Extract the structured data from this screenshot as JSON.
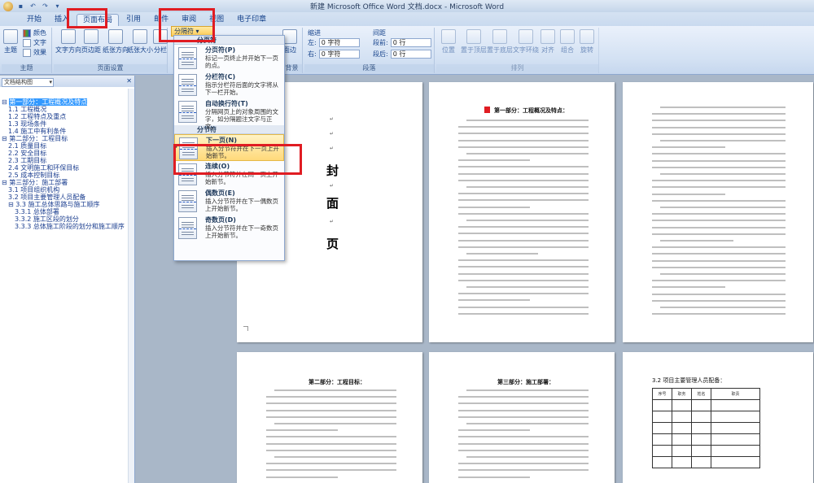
{
  "window": {
    "title": "新建 Microsoft Office Word 文档.docx - Microsoft Word"
  },
  "tabs": [
    "开始",
    "插入",
    "页面布局",
    "引用",
    "邮件",
    "审阅",
    "视图",
    "电子印章"
  ],
  "active_tab": "页面布局",
  "ribbon": {
    "themes": {
      "label": "主题",
      "big": "主题",
      "items": [
        "颜色",
        "文字",
        "效果"
      ]
    },
    "page_setup": {
      "label": "页面设置",
      "buttons": [
        "文字方向",
        "页边距",
        "纸张方向",
        "纸张大小",
        "分栏"
      ]
    },
    "breaks_button": "分隔符",
    "page_background": {
      "label": "页面背景",
      "buttons": [
        "页面边框"
      ]
    },
    "paragraph": {
      "label": "段落",
      "indent_label": "缩进",
      "spacing_label": "间距",
      "left": "左:",
      "right": "右:",
      "left_value": "0 字符",
      "right_value": "0 字符",
      "before": "段前:",
      "after": "段后:",
      "before_value": "0 行",
      "after_value": "0 行"
    },
    "arrange": {
      "label": "排列",
      "buttons": [
        "位置",
        "置于顶层",
        "置于底层",
        "文字环绕",
        "对齐",
        "组合",
        "旋转"
      ]
    }
  },
  "nav_pane": {
    "view_select": "文档结构图",
    "items": [
      {
        "text": "第一部分：工程概况及特点",
        "level": 0,
        "selected": true
      },
      {
        "text": "1.1 工程概况",
        "level": 1
      },
      {
        "text": "1.2 工程特点及重点",
        "level": 1
      },
      {
        "text": "1.3 现场条件",
        "level": 1
      },
      {
        "text": "1.4 施工中有利条件",
        "level": 1
      },
      {
        "text": "第二部分：工程目标",
        "level": 0
      },
      {
        "text": "2.1 质量目标",
        "level": 1
      },
      {
        "text": "2.2 安全目标",
        "level": 1
      },
      {
        "text": "2.3 工期目标",
        "level": 1
      },
      {
        "text": "2.4 文明施工和环保目标",
        "level": 1
      },
      {
        "text": "2.5 成本控制目标",
        "level": 1
      },
      {
        "text": "第三部分：施工部署",
        "level": 0
      },
      {
        "text": "3.1 项目组织机构",
        "level": 1
      },
      {
        "text": "3.2 项目主要管理人员配备",
        "level": 1
      },
      {
        "text": "3.3 施工总体思路与施工顺序",
        "level": 1
      },
      {
        "text": "3.3.1 总体部署",
        "level": 2
      },
      {
        "text": "3.3.2 施工区段的划分",
        "level": 2
      },
      {
        "text": "3.3.3 总体施工阶段的划分和施工顺序",
        "level": 2
      }
    ]
  },
  "breaks_menu": {
    "sections": [
      {
        "header": "分页符",
        "items": [
          {
            "title": "分页符(P)",
            "desc": "标记一页终止并开始下一页的点。"
          },
          {
            "title": "分栏符(C)",
            "desc": "指示分栏符后面的文字将从下一栏开始。"
          },
          {
            "title": "自动换行符(T)",
            "desc": "分隔网页上的对象周围的文字，如分隔题注文字与正文。"
          }
        ]
      },
      {
        "header": "分节符",
        "items": [
          {
            "title": "下一页(N)",
            "desc": "插入分节符并在下一页上开始新节。",
            "hover": true
          },
          {
            "title": "连续(O)",
            "desc": "插入分节符并在同一页上开始新节。"
          },
          {
            "title": "偶数页(E)",
            "desc": "插入分节符并在下一偶数页上开始新节。"
          },
          {
            "title": "奇数页(D)",
            "desc": "插入分节符并在下一奇数页上开始新节。"
          }
        ]
      }
    ]
  },
  "document": {
    "cover_chars": [
      "封",
      "面",
      "页"
    ],
    "page2_title": "第一部分：工程概况及特点：",
    "page4_title": "第二部分：工程目标：",
    "page5_title": "第三部分：施工部署：",
    "page6_title": "3.2 项目主要管理人员配备：",
    "page6_table_head": [
      "序号",
      "职务",
      "姓名",
      "职责"
    ]
  }
}
